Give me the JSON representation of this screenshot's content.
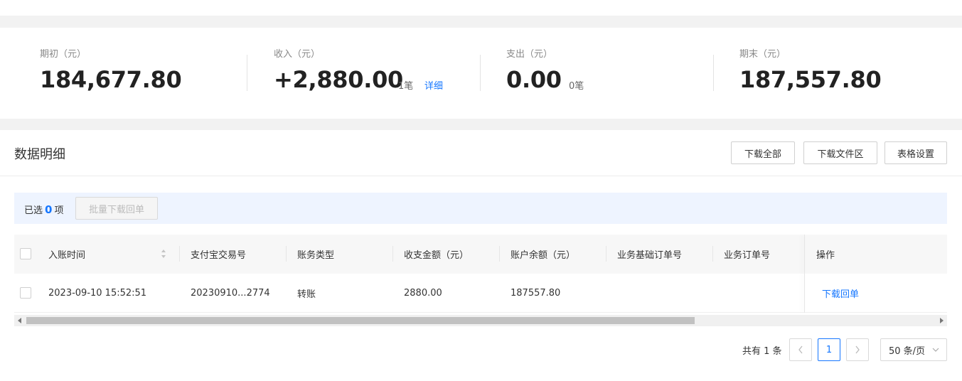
{
  "summary": {
    "opening": {
      "label": "期初（元）",
      "value": "184,677.80"
    },
    "income": {
      "label": "收入（元）",
      "value": "+2,880.00",
      "count": "1笔",
      "detail_link": "详细"
    },
    "expense": {
      "label": "支出（元）",
      "value": "0.00",
      "count": "0笔"
    },
    "closing": {
      "label": "期末（元）",
      "value": "187,557.80"
    }
  },
  "detail": {
    "title": "数据明细",
    "buttons": {
      "download_all": "下载全部",
      "download_files": "下载文件区",
      "table_settings": "表格设置"
    }
  },
  "selection": {
    "prefix": "已选",
    "count": "0",
    "suffix": "项",
    "batch_button": "批量下载回单"
  },
  "table": {
    "columns": [
      "入账时间",
      "支付宝交易号",
      "账务类型",
      "收支金额（元）",
      "账户余额（元）",
      "业务基础订单号",
      "业务订单号",
      "操作"
    ],
    "rows": [
      {
        "time": "2023-09-10 15:52:51",
        "trade_no": "20230910...2774",
        "type": "转账",
        "amount": "2880.00",
        "balance": "187557.80",
        "base_order_no": "",
        "order_no": "",
        "action": "下载回单"
      }
    ]
  },
  "pagination": {
    "total": "共有 1 条",
    "current_page": "1",
    "page_size": "50 条/页"
  },
  "colors": {
    "accent": "#1677ff",
    "selection_bg": "#eef4ff",
    "header_bg": "#f7f7f7"
  }
}
